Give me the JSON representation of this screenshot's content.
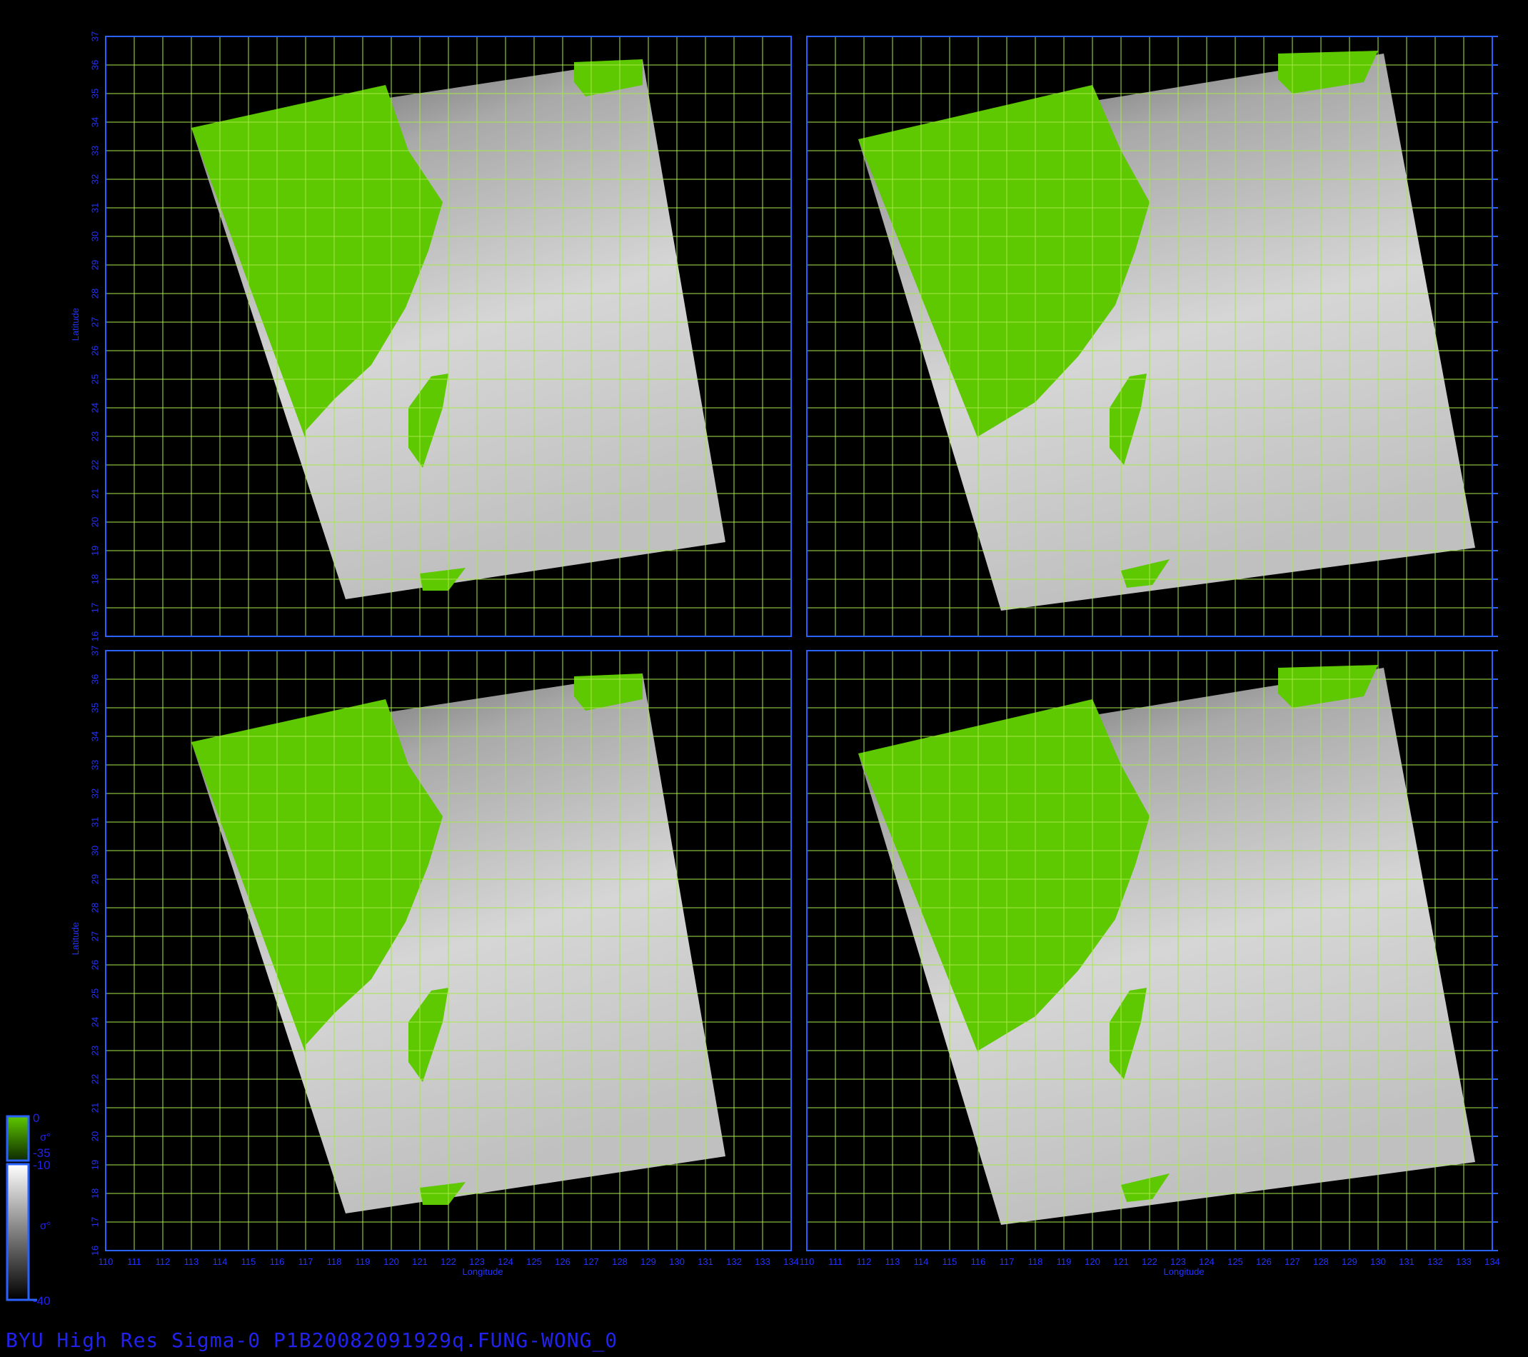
{
  "figure": {
    "title": "BYU High Res Sigma-0 P1B20082091929q.FUNG-WONG_0",
    "xlabel": "Longitude",
    "ylabel": "Latitude",
    "lon_range": [
      110,
      134
    ],
    "lat_range": [
      16,
      37
    ],
    "panels": [
      "top-left",
      "top-right",
      "bottom-left",
      "bottom-right"
    ],
    "grid": true
  },
  "colorbar": {
    "land_scale": {
      "max": "0",
      "sigma_label": "σ°",
      "min": "-35"
    },
    "ocean_scale": {
      "max": "-10",
      "sigma_label": "σ°",
      "min": "-40"
    }
  },
  "colors": {
    "land": "#5ec800",
    "grid": "#a6e84a",
    "frame": "#2a62ff",
    "axis_text": "#2233ff",
    "background": "#000000"
  }
}
